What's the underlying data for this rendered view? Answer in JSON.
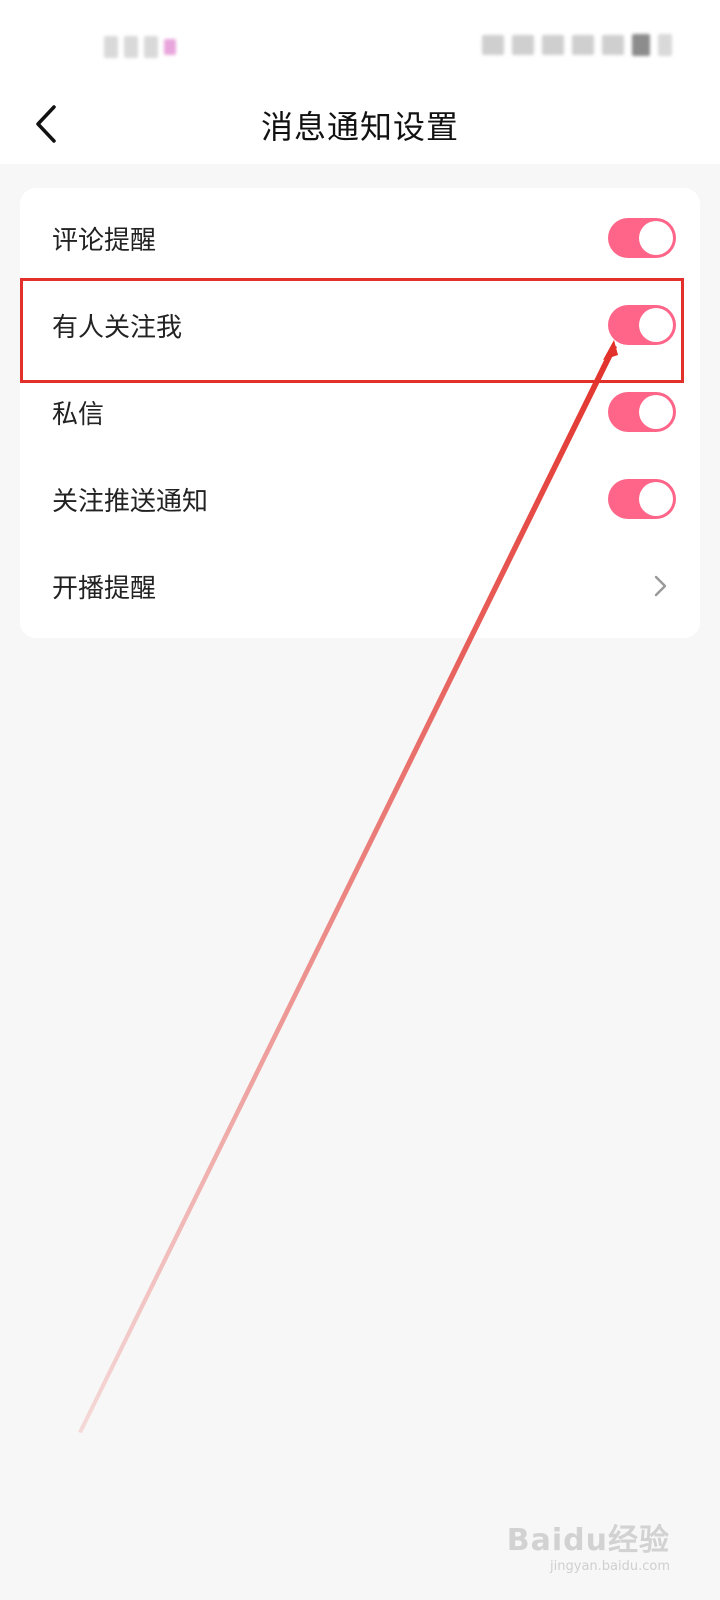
{
  "header": {
    "title": "消息通知设置",
    "back_icon": "chevron-left-icon"
  },
  "settings": [
    {
      "label": "评论提醒",
      "control": "toggle",
      "on": true
    },
    {
      "label": "有人关注我",
      "control": "toggle",
      "on": true
    },
    {
      "label": "私信",
      "control": "toggle",
      "on": true
    },
    {
      "label": "关注推送通知",
      "control": "toggle",
      "on": true
    },
    {
      "label": "开播提醒",
      "control": "chevron-right-icon"
    }
  ],
  "colors": {
    "toggle_on": "#fe6588",
    "annotation_red": "#e2312b",
    "page_background": "#f7f7f7"
  },
  "watermark": {
    "main": "Baidu经验",
    "sub": "jingyan.baidu.com"
  }
}
